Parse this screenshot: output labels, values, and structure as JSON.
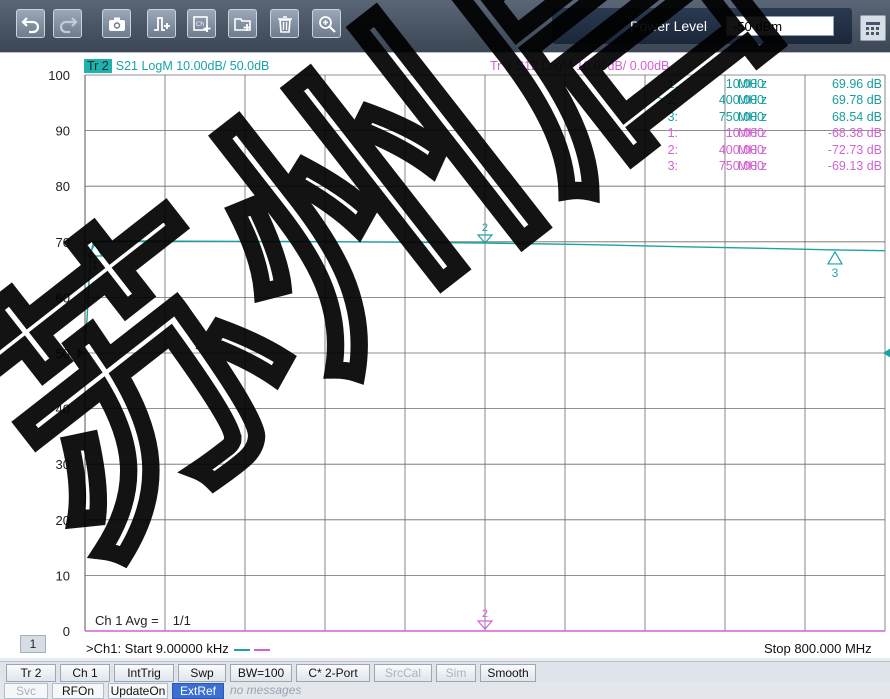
{
  "toolbar": {
    "buttons": [
      {
        "name": "undo-button",
        "icon": "undo-icon"
      },
      {
        "name": "redo-button",
        "icon": "redo-icon"
      },
      {
        "name": "screenshot-button",
        "icon": "camera-icon"
      },
      {
        "name": "add-trace-button",
        "icon": "add-trace-icon"
      },
      {
        "name": "add-channel-button",
        "icon": "add-channel-icon"
      },
      {
        "name": "add-window-button",
        "icon": "add-window-icon"
      },
      {
        "name": "delete-button",
        "icon": "trash-icon"
      },
      {
        "name": "zoom-button",
        "icon": "zoom-in-icon"
      }
    ],
    "power_label": "Power Level",
    "power_value": "-50 dBm"
  },
  "traces": {
    "tr2": {
      "tag": "Tr 2",
      "text": "S21 LogM 10.00dB/ 50.0dB",
      "color": "#1aa3a3"
    },
    "tr3": {
      "tag": "Tr 3",
      "text": "S12 LogM 10.00dB/ 0.00dB",
      "color": "#d55fd5"
    }
  },
  "markers": {
    "s21": [
      {
        "id": "1:",
        "freq": "10.000",
        "unit": "MH z",
        "value": "69.96 dB"
      },
      {
        "id": "> 2:",
        "freq": "400.000",
        "unit": "MH z",
        "value": "69.78 dB"
      },
      {
        "id": "3:",
        "freq": "750.000",
        "unit": "MH z",
        "value": "68.54 dB"
      }
    ],
    "s12": [
      {
        "id": "1:",
        "freq": "10.000",
        "unit": "MH z",
        "value": "-68.38 dB"
      },
      {
        "id": "2:",
        "freq": "400.000",
        "unit": "MH z",
        "value": "-72.73 dB"
      },
      {
        "id": "3:",
        "freq": "750.000",
        "unit": "MH z",
        "value": "-69.13 dB"
      }
    ]
  },
  "chart_data": {
    "type": "line",
    "x_range_mhz": [
      0.009,
      800
    ],
    "y_range": [
      0,
      100
    ],
    "y_ticks": [
      0,
      10,
      20,
      30,
      40,
      50,
      60,
      70,
      80,
      90,
      100
    ],
    "x_divisions": 10,
    "grid": true,
    "series": [
      {
        "name": "S21",
        "color": "#1aa3a3",
        "x": [
          0.009,
          2,
          4,
          6,
          8,
          10,
          20,
          50,
          100,
          200,
          300,
          400,
          500,
          600,
          700,
          750,
          800
        ],
        "y": [
          52,
          56,
          63,
          68,
          69.6,
          69.96,
          70.1,
          70.15,
          70.1,
          70.05,
          69.95,
          69.78,
          69.5,
          69.1,
          68.75,
          68.54,
          68.4
        ]
      }
    ],
    "marker_labels_s21": [
      "1",
      "2",
      "3"
    ],
    "marker_labels_s12": [
      "2"
    ]
  },
  "average": {
    "label": "Ch 1 Avg =",
    "value": "1/1"
  },
  "channel_number": "1",
  "start_text": ">Ch1: Start  9.00000 kHz",
  "stop_text": "Stop  800.000 MHz",
  "softkeys": [
    "Tr 2",
    "Ch 1",
    "IntTrig",
    "Swp",
    "BW=100",
    "C* 2-Port",
    "SrcCal",
    "Sim",
    "Smooth"
  ],
  "status": [
    "Svc",
    "RFOn",
    "UpdateOn",
    "ExtRef",
    "no messages"
  ],
  "watermark_text": "苏州启"
}
